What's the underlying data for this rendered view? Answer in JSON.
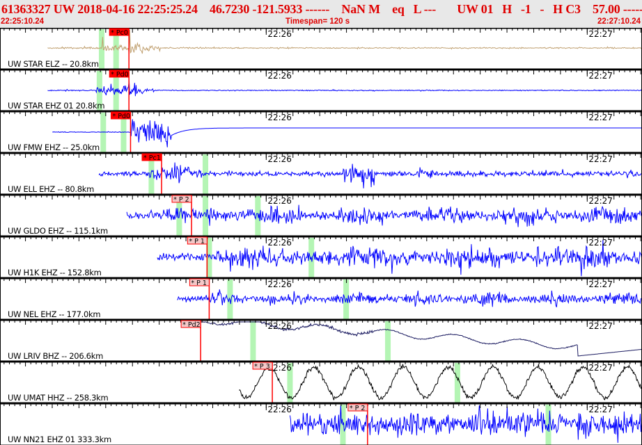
{
  "header": {
    "title": "61363327 UW 2018-04-16 22:25:25.24    46.7230 -121.5933 ------    NaN M    eq   L ---       UW 01   H   -1   -   H C3    57.00 -----",
    "start_time": "22:25:10.24",
    "timespan": "Timespan= 120 s",
    "end_time": "22:27:10.24"
  },
  "time_axis": {
    "span_seconds": 120,
    "tick_labels": [
      {
        "label": "22:26",
        "t": 49.76
      },
      {
        "label": "22:27",
        "t": 109.76
      }
    ]
  },
  "colors": {
    "trace_blue": "#0000ff",
    "trace_tan": "#c0a070",
    "trace_navy": "#1a1a60",
    "trace_black": "#000000",
    "pick_red": "#ff0000",
    "pick_pink": "#f4c8c8",
    "band_green": "#b4f5b4"
  },
  "channels": [
    {
      "label": "UW STAR ELZ -- 20.8km",
      "color": "#c0a070",
      "pick": {
        "label": "* Pc0",
        "t": 24.1,
        "style": "solid"
      },
      "bands": [
        19.0,
        21.7
      ],
      "start": 8.9
    },
    {
      "label": "UW STAR EHZ 01 20.8km",
      "color": "#0000ff",
      "pick": {
        "label": "* Pd0",
        "t": 24.1,
        "style": "solid"
      },
      "bands": [
        18.6,
        21.7
      ],
      "start": 8.9
    },
    {
      "label": "UW FMW EHZ -- 25.0km",
      "color": "#0000ff",
      "pick": {
        "label": "* Pd0",
        "t": 24.4,
        "style": "solid"
      },
      "bands": [
        19.3,
        23.1
      ],
      "start": 9.8
    },
    {
      "label": "UW ELL EHZ -- 80.8km",
      "color": "#0000ff",
      "pick": {
        "label": "* Pc1",
        "t": 30.2,
        "style": "solid"
      },
      "bands": [
        28.3,
        38.4
      ],
      "start": 18.5
    },
    {
      "label": "UW GLDO EHZ -- 115.1km",
      "color": "#0000ff",
      "pick": {
        "label": "* P 2",
        "t": 35.8,
        "style": "light"
      },
      "bands": [
        33.5,
        38.4,
        48.2
      ],
      "start": 23.7
    },
    {
      "label": "UW H1K EHZ -- 152.8km",
      "color": "#0000ff",
      "pick": {
        "label": "* P 1",
        "t": 38.7,
        "style": "light"
      },
      "bands": [
        39.1,
        58.2
      ],
      "start": 29.4
    },
    {
      "label": "UW NEL EHZ -- 177.0km",
      "color": "#0000ff",
      "pick": {
        "label": "* P 1",
        "t": 39.1,
        "style": "light"
      },
      "bands": [
        43.0,
        64.7
      ],
      "start": 33.1
    },
    {
      "label": "UW LRIV BHZ -- 206.6km",
      "color": "#1a1a60",
      "pick": {
        "label": "* Pd2",
        "t": 37.5,
        "style": "light"
      },
      "bands": [
        47.3,
        72.5
      ],
      "start": 37.5
    },
    {
      "label": "UW UMAT HHZ -- 258.3km",
      "color": "#000000",
      "pick": {
        "label": "* P 3",
        "t": 50.9,
        "style": "light"
      },
      "bands": [
        54.2,
        85.5
      ],
      "start": 44.7
    },
    {
      "label": "UW NN21 EHZ 01 333.3km",
      "color": "#0000ff",
      "pick": {
        "label": "* P 2",
        "t": 68.7,
        "style": "light"
      },
      "bands": [
        64.1,
        102.5
      ],
      "start": 54.2
    }
  ]
}
